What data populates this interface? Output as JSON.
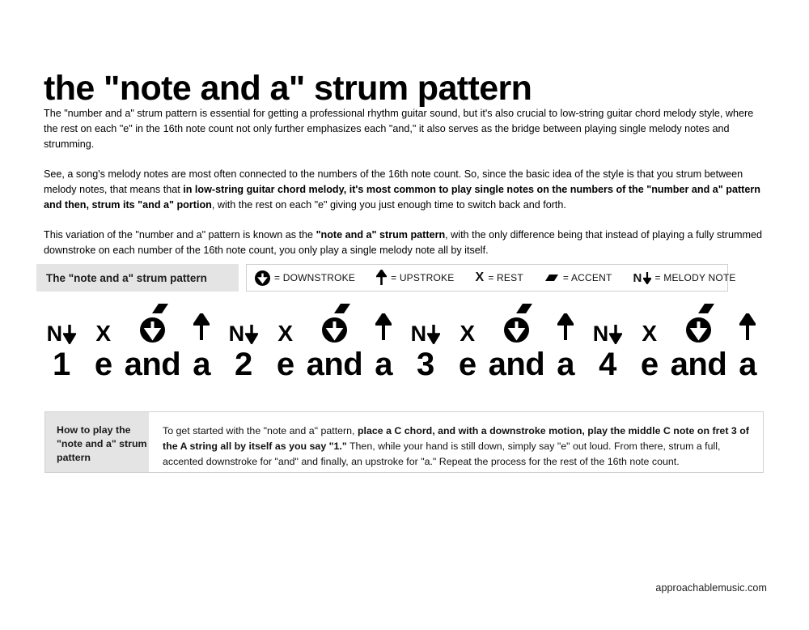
{
  "page": {
    "title": "the \"note and a\" strum pattern",
    "footer": "approachablemusic.com",
    "background_color": "#ffffff",
    "panel_gray": "#e4e4e4",
    "border_gray": "#d2d2d2"
  },
  "paragraphs": [
    {
      "runs": [
        {
          "text": "The \"number and a\" strum pattern is essential for getting a professional rhythm guitar sound, but it's also crucial to low-string guitar chord melody style, where the rest on each \"e\" in the 16th note count not only further emphasizes each \"and,\" it also serves as the bridge between playing single melody notes and strumming.",
          "bold": false
        }
      ]
    },
    {
      "runs": [
        {
          "text": "See, a song's melody notes are most often connected to the numbers of the 16th note count. So, since the basic idea of the style is that you strum between melody notes, that means that ",
          "bold": false
        },
        {
          "text": "in low-string guitar chord melody, it's most common to play single notes on the numbers of the \"number and a\" pattern and then, strum its \"and a\" portion",
          "bold": true
        },
        {
          "text": ", with the rest on each \"e\" giving you just enough time to switch back and forth.",
          "bold": false
        }
      ]
    },
    {
      "runs": [
        {
          "text": "This variation of the \"number and a\" pattern is known as the ",
          "bold": false
        },
        {
          "text": "\"note and a\" strum pattern",
          "bold": true
        },
        {
          "text": ", with the only difference being that instead of playing a fully strummed downstroke on each number of the 16th note count, you only play a single melody note all by itself.",
          "bold": false
        }
      ]
    }
  ],
  "legend": {
    "title": "The \"note and a\" strum pattern",
    "items": [
      {
        "icon": "downstroke-circle-icon",
        "label": "= DOWNSTROKE"
      },
      {
        "icon": "upstroke-arrow-icon",
        "label": "= UPSTROKE"
      },
      {
        "icon": "rest-x-icon",
        "label": "= REST"
      },
      {
        "icon": "accent-wedge-icon",
        "label": "= ACCENT"
      },
      {
        "icon": "melody-note-icon",
        "label": "= MELODY NOTE"
      }
    ],
    "rest_glyph": "X",
    "melody_glyph": "N"
  },
  "notation": {
    "counts": [
      "1",
      "e",
      "and",
      "a",
      "2",
      "e",
      "and",
      "a",
      "3",
      "e",
      "and",
      "a",
      "4",
      "e",
      "and",
      "a"
    ],
    "symbols": [
      "melody-note",
      "rest",
      "accent-downstroke",
      "upstroke",
      "melody-note",
      "rest",
      "accent-downstroke",
      "upstroke",
      "melody-note",
      "rest",
      "accent-downstroke",
      "upstroke",
      "melody-note",
      "rest",
      "accent-downstroke",
      "upstroke"
    ],
    "melody_glyph": "N",
    "rest_glyph": "X"
  },
  "howto": {
    "label": "How to play the \"note and a\" strum pattern",
    "runs": [
      {
        "text": "To get started with the \"note and a\" pattern, ",
        "bold": false
      },
      {
        "text": "place a C chord, and with a downstroke motion, play the middle C note on fret 3 of the A string all by itself as you say \"1.\"",
        "bold": true
      },
      {
        "text": " Then, while your hand is still down, simply say \"e\" out loud. From there, strum a full, accented downstroke for \"and\" and finally, an upstroke for \"a.\" Repeat the process for the rest of the 16th note count.",
        "bold": false
      }
    ]
  }
}
